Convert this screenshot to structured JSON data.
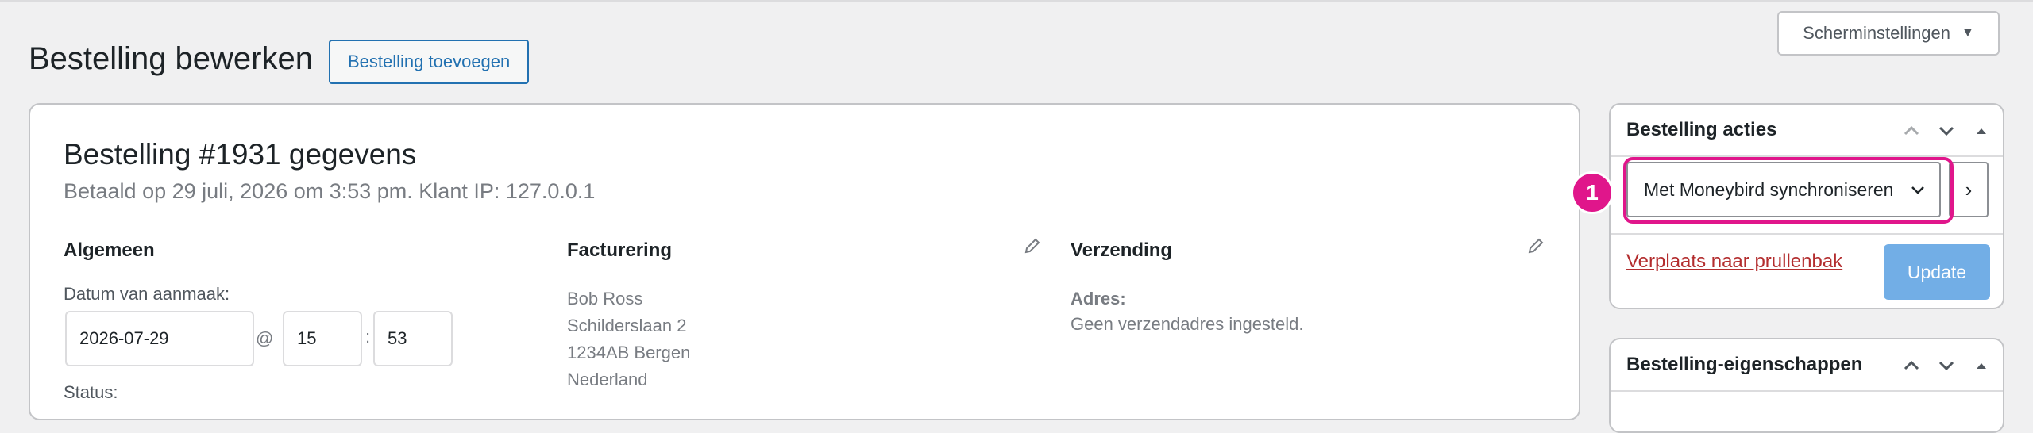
{
  "header": {
    "screen_options": "Scherminstellingen",
    "title": "Bestelling bewerken",
    "add_button": "Bestelling toevoegen"
  },
  "order": {
    "title": "Bestelling #1931 gegevens",
    "subtitle": "Betaald op 29 juli, 2026 om 3:53 pm. Klant IP: 127.0.0.1",
    "general": {
      "title": "Algemeen",
      "created_label": "Datum van aanmaak:",
      "date": "2026-07-29",
      "at": "@",
      "hour": "15",
      "colon": ":",
      "minute": "53",
      "status_label": "Status:"
    },
    "billing": {
      "title": "Facturering",
      "lines": [
        "Bob Ross",
        "Schilderslaan 2",
        "1234AB Bergen",
        "Nederland"
      ]
    },
    "shipping": {
      "title": "Verzending",
      "address_label": "Adres:",
      "address_value": "Geen verzendadres ingesteld."
    }
  },
  "actions_box": {
    "title": "Bestelling acties",
    "selected_action": "Met Moneybird synchroniseren",
    "go_label": "›",
    "trash_link": "Verplaats naar prullenbak",
    "update_button": "Update",
    "badge": "1"
  },
  "properties_box": {
    "title": "Bestelling-eigenschappen"
  },
  "colors": {
    "accent": "#2271b1",
    "highlight": "#e0168b",
    "update_button": "#72aee6",
    "trash": "#b32d2e"
  }
}
